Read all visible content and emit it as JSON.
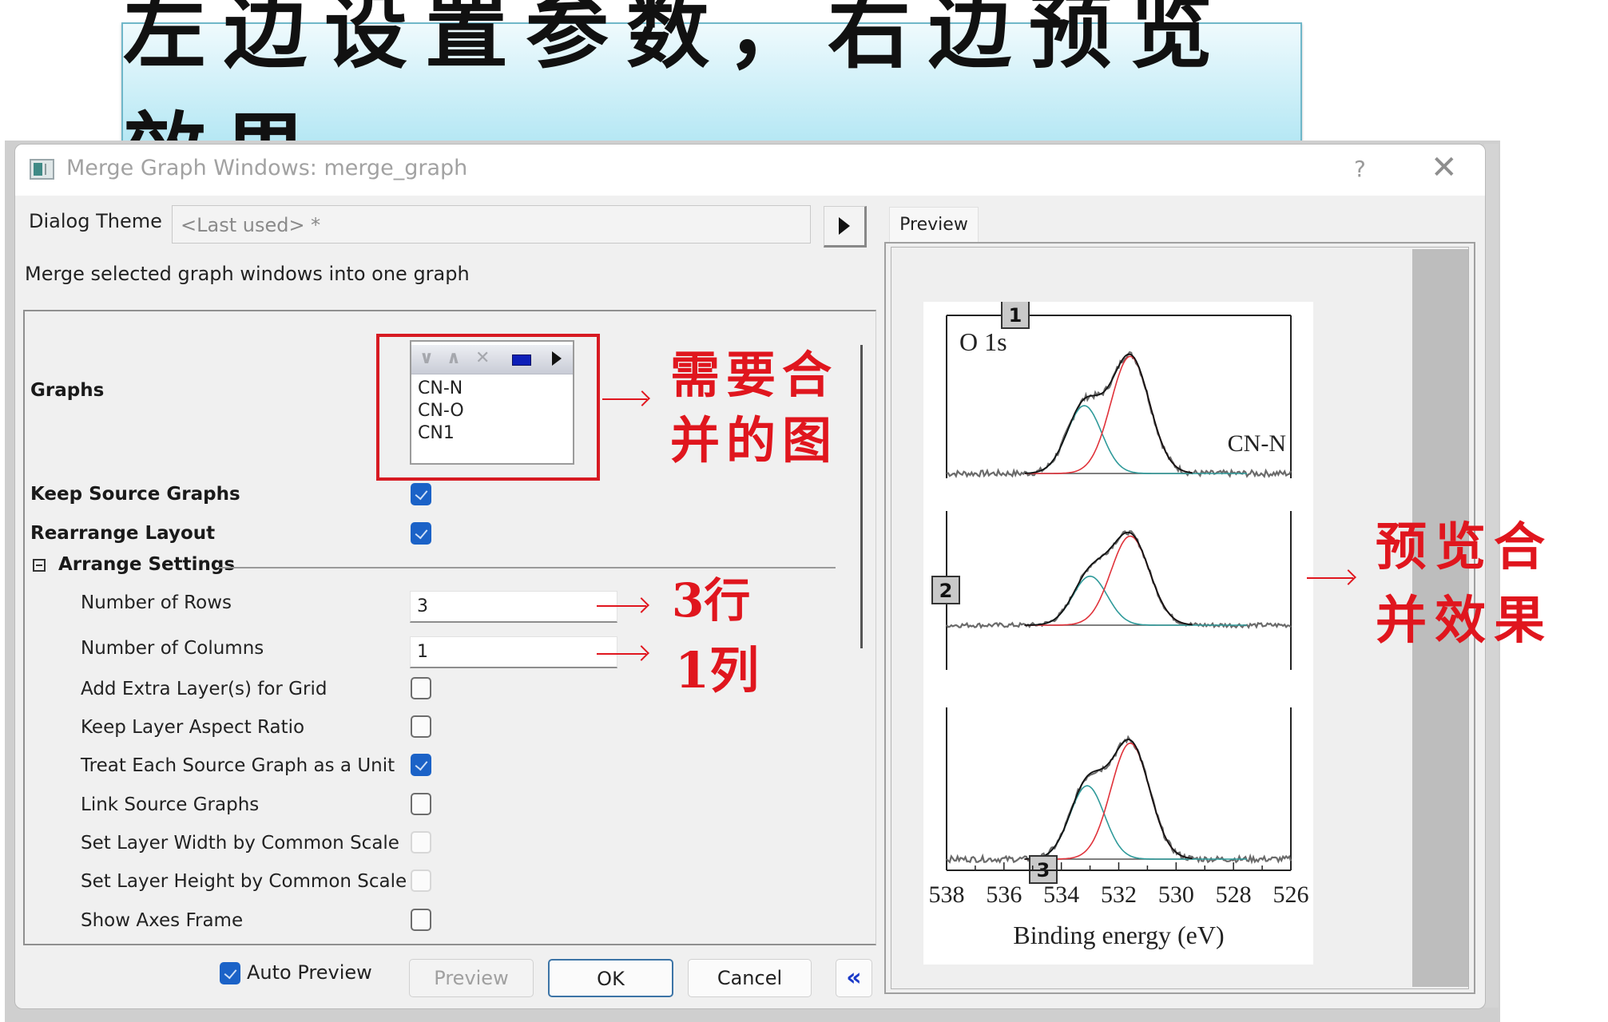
{
  "banner": {
    "text": "左边设置参数，右边预览效果"
  },
  "dialog": {
    "title": "Merge Graph Windows: merge_graph",
    "help_label": "?",
    "close_label": "✕",
    "theme_label": "Dialog Theme",
    "theme_value": "<Last used> *",
    "description": "Merge selected graph windows into one graph",
    "settings": {
      "graphs_label": "Graphs",
      "graphs_list": [
        "CN-N",
        "CN-O",
        "CN1"
      ],
      "list_toolbar_icons": [
        "move-down-icon",
        "move-up-icon",
        "remove-icon",
        "select-window-icon",
        "more-icon"
      ],
      "keep_source_label": "Keep Source Graphs",
      "keep_source_checked": true,
      "rearrange_label": "Rearrange Layout",
      "rearrange_checked": true,
      "arrange_section_label": "Arrange Settings",
      "arrange_section_expanded": true,
      "rows_label": "Number of Rows",
      "rows_value": "3",
      "cols_label": "Number of Columns",
      "cols_value": "1",
      "options": [
        {
          "label": "Add Extra Layer(s) for Grid",
          "checked": false,
          "enabled": true
        },
        {
          "label": "Keep Layer Aspect Ratio",
          "checked": false,
          "enabled": true
        },
        {
          "label": "Treat Each Source Graph as a Unit",
          "checked": true,
          "enabled": true
        },
        {
          "label": "Link Source Graphs",
          "checked": false,
          "enabled": true
        },
        {
          "label": "Set Layer Width by Common Scale",
          "checked": false,
          "enabled": false
        },
        {
          "label": "Set Layer Height by Common Scale",
          "checked": false,
          "enabled": false
        },
        {
          "label": "Show Axes Frame",
          "checked": false,
          "enabled": true
        }
      ]
    },
    "footer": {
      "auto_preview_label": "Auto Preview",
      "auto_preview_checked": true,
      "preview_label": "Preview",
      "ok_label": "OK",
      "cancel_label": "Cancel",
      "collapse_label": "«"
    },
    "preview_tab_label": "Preview"
  },
  "annotations": {
    "graphs_note": [
      "需要合",
      "并的图"
    ],
    "rows_note": "3行",
    "cols_note": "1列",
    "preview_note": [
      "预览合",
      "并效果"
    ]
  },
  "chart_data": {
    "type": "line",
    "title": "",
    "element_label": "O 1s",
    "xlabel": "Binding energy (eV)",
    "ylabel": "",
    "xlim": [
      538,
      526
    ],
    "xticks": [
      538,
      536,
      534,
      532,
      530,
      528,
      526
    ],
    "layers": [
      {
        "layer": "1",
        "source": "CN-N",
        "label": "CN-N",
        "peaks": [
          {
            "name": "fit-teal",
            "center": 533.2,
            "rel_height": 0.55,
            "color": "#2f9a9a"
          },
          {
            "name": "fit-red",
            "center": 531.6,
            "rel_height": 0.95,
            "color": "#e0323a"
          }
        ]
      },
      {
        "layer": "2",
        "source": "CN-O",
        "label": "",
        "peaks": [
          {
            "name": "fit-teal",
            "center": 533.0,
            "rel_height": 0.55,
            "color": "#2f9a9a"
          },
          {
            "name": "fit-red",
            "center": 531.6,
            "rel_height": 1.0,
            "color": "#e0323a"
          }
        ]
      },
      {
        "layer": "3",
        "source": "CN1",
        "label": "",
        "peaks": [
          {
            "name": "fit-teal",
            "center": 533.1,
            "rel_height": 0.62,
            "color": "#2f9a9a"
          },
          {
            "name": "fit-red",
            "center": 531.6,
            "rel_height": 0.98,
            "color": "#e0323a"
          }
        ]
      }
    ],
    "grid": false,
    "legend": "none"
  }
}
